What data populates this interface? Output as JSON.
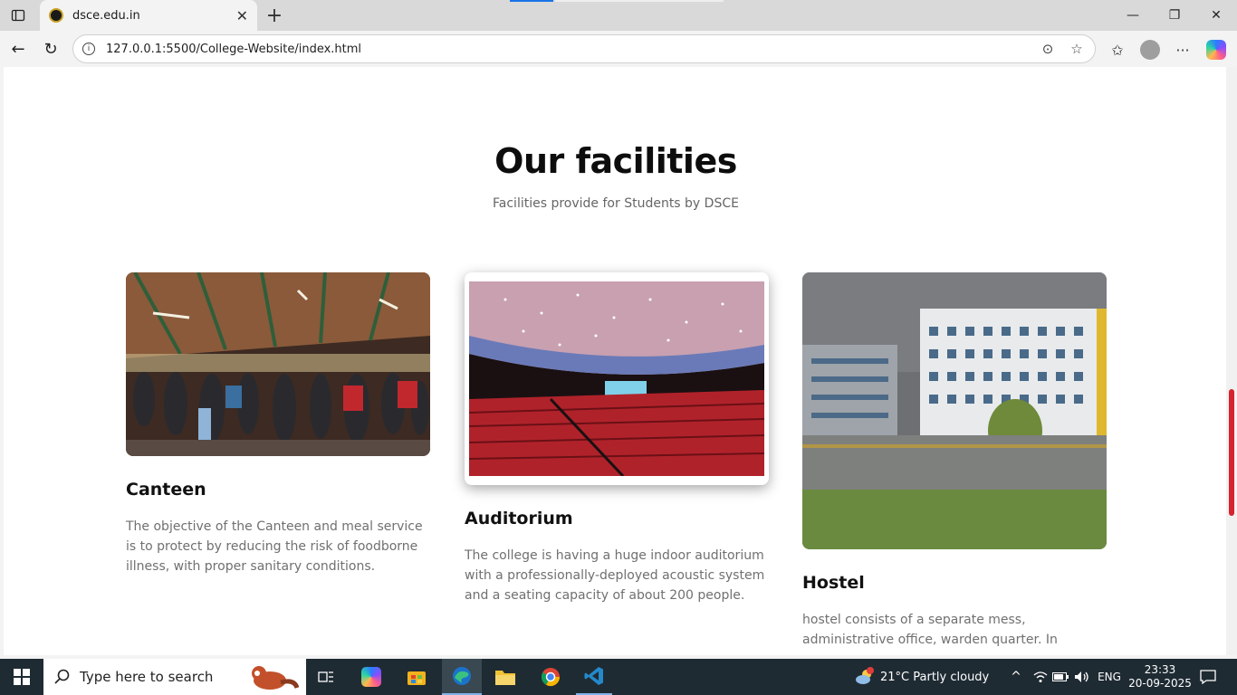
{
  "browser": {
    "tab_title": "dsce.edu.in",
    "url": "127.0.0.1:5500/College-Website/index.html"
  },
  "page": {
    "heading": "Our facilities",
    "subheading": "Facilities provide for Students by DSCE",
    "cards": [
      {
        "title": "Canteen",
        "text": "The objective of the Canteen and meal service is to protect by reducing the risk of foodborne illness, with proper sanitary conditions."
      },
      {
        "title": "Auditorium",
        "text": "The college is having a huge indoor auditorium with a professionally-deployed acoustic system and a seating capacity of about 200 people."
      },
      {
        "title": "Hostel",
        "text": "hostel consists of a separate mess, administrative office, warden quarter. In"
      }
    ]
  },
  "taskbar": {
    "search_placeholder": "Type here to search",
    "weather": "21°C  Partly cloudy",
    "language": "ENG",
    "time": "23:33",
    "date": "20-09-2025"
  },
  "colors": {
    "accent": "#d5232f",
    "edge_blue": "#1a73e8"
  }
}
